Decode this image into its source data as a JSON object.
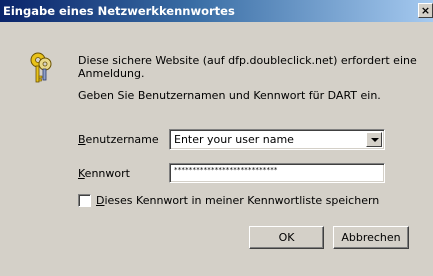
{
  "window": {
    "title": "Eingabe eines Netzwerkkennwortes",
    "close_glyph": "×"
  },
  "message": {
    "line1": "Diese sichere Website (auf dfp.doubleclick.net) erfordert eine",
    "line2": "Anmeldung.",
    "line3": "Geben Sie Benutzernamen und Kennwort für DART ein."
  },
  "form": {
    "username_label_accel": "B",
    "username_label_rest": "enutzername",
    "username_value": "Enter your user name",
    "password_label_accel": "K",
    "password_label_rest": "ennwort",
    "password_value": "****************************",
    "remember_accel": "D",
    "remember_rest": "ieses Kennwort in meiner Kennwortliste speichern",
    "remember_checked": false
  },
  "buttons": {
    "ok": "OK",
    "cancel": "Abbrechen"
  },
  "colors": {
    "titlebar_start": "#0a246a",
    "titlebar_end": "#a6caf0",
    "dialog_bg": "#d4d0c8"
  },
  "icons": {
    "key": "key-icon",
    "dropdown": "chevron-down-icon",
    "close": "close-icon"
  }
}
